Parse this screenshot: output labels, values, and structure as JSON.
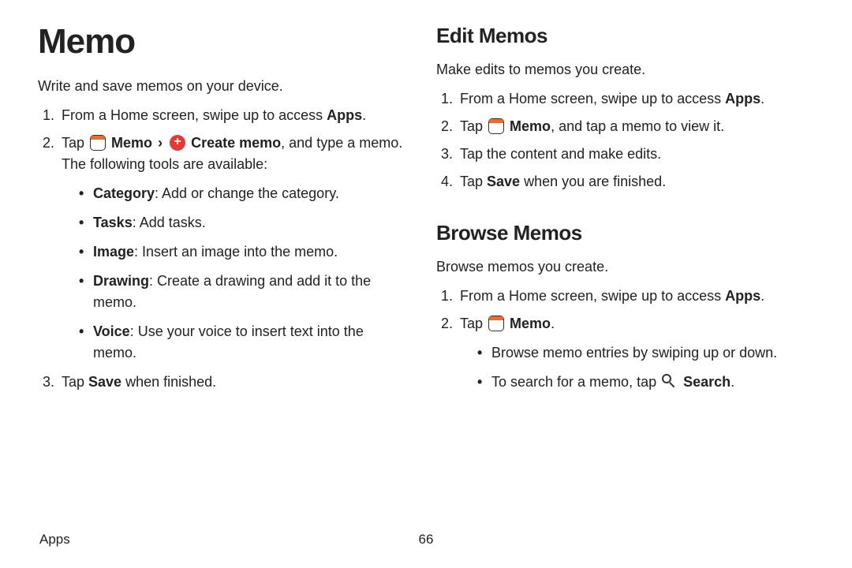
{
  "footer": {
    "section": "Apps",
    "page": "66"
  },
  "left": {
    "title": "Memo",
    "intro": "Write and save memos on your device.",
    "step1": {
      "pre": "From a Home screen, swipe up to access ",
      "bold": "Apps",
      "post": "."
    },
    "step2": {
      "pre": "Tap ",
      "memoLabel": "Memo",
      "chev": "›",
      "createLabel": "Create memo",
      "post": ", and type a memo. The following tools are available:"
    },
    "tools": {
      "cat": {
        "label": "Category",
        "desc": ": Add or change the category."
      },
      "tasks": {
        "label": "Tasks",
        "desc": ": Add tasks."
      },
      "image": {
        "label": "Image",
        "desc": ": Insert an image into the memo."
      },
      "draw": {
        "label": "Drawing",
        "desc": ": Create a drawing and add it to the memo."
      },
      "voice": {
        "label": "Voice",
        "desc": ": Use your voice to insert text into the memo."
      }
    },
    "step3": {
      "pre": "Tap ",
      "bold": "Save",
      "post": " when finished."
    }
  },
  "right": {
    "edit": {
      "title": "Edit Memos",
      "intro": "Make edits to memos you create.",
      "step1": {
        "pre": "From a Home screen, swipe up to access ",
        "bold": "Apps",
        "post": "."
      },
      "step2": {
        "pre": "Tap ",
        "memoLabel": "Memo",
        "post": ", and tap a memo to view it."
      },
      "step3": "Tap the content and make edits.",
      "step4": {
        "pre": "Tap ",
        "bold": "Save",
        "post": " when you are finished."
      }
    },
    "browse": {
      "title": "Browse Memos",
      "intro": "Browse memos you create.",
      "step1": {
        "pre": "From a Home screen, swipe up to access ",
        "bold": "Apps",
        "post": "."
      },
      "step2": {
        "pre": "Tap ",
        "memoLabel": "Memo",
        "post": "."
      },
      "bullets": {
        "a": "Browse memo entries by swiping up or down.",
        "b": {
          "pre": "To search for a memo, tap ",
          "bold": "Search",
          "post": "."
        }
      }
    }
  }
}
